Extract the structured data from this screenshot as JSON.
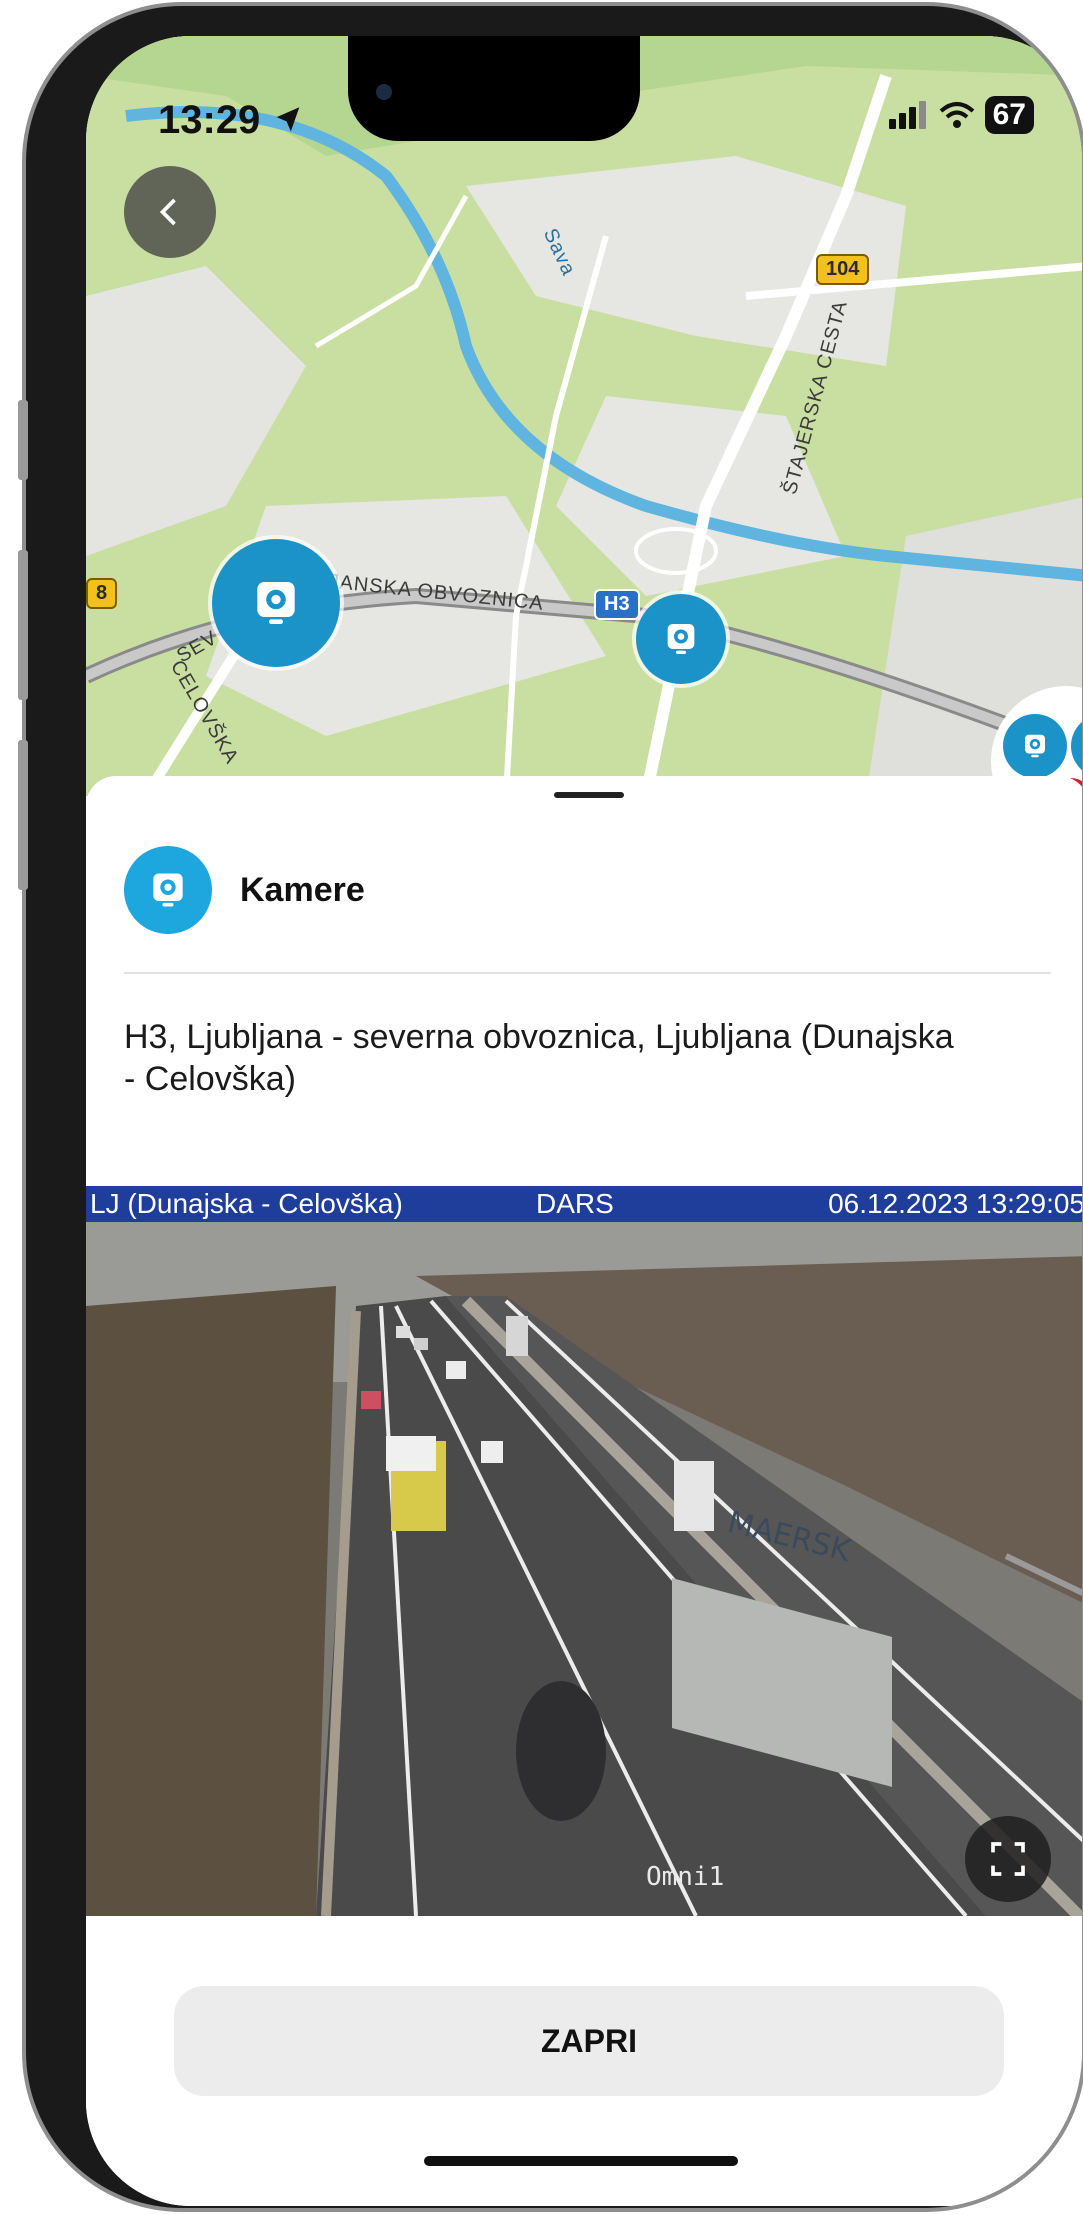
{
  "status_bar": {
    "time": "13:29",
    "battery": "67"
  },
  "map": {
    "labels": {
      "sava": "Sava",
      "stajerska": "ŠTAJERSKA CESTA",
      "obvoznica": "LJANSKA OBVOZNICA",
      "celovska": "CELOVŠKA",
      "sev": "SEV"
    },
    "shields": {
      "r104": "104",
      "h3": "H3",
      "r8": "8"
    }
  },
  "sheet": {
    "title": "Kamere",
    "description": "H3, Ljubljana - severna obvoznica, Ljubljana (Dunajska - Celovška)",
    "camera_overlay": {
      "location": "LJ (Dunajska - Celovška)",
      "operator": "DARS",
      "timestamp": "06.12.2023 13:29:05",
      "camera_id": "Omni1",
      "truck_brand": "MAERSK"
    },
    "close_label": "ZAPRI"
  },
  "colors": {
    "accent": "#1ea6df",
    "marker": "#1b93c9",
    "overlay_bar": "#1f3d9a",
    "map_green": "#c9dfa1",
    "river": "#5fb4e0"
  },
  "icons": {
    "back": "chevron-left-icon",
    "camera": "camera-icon",
    "expand": "expand-icon",
    "location": "location-arrow-icon",
    "signal": "signal-icon",
    "wifi": "wifi-icon"
  }
}
